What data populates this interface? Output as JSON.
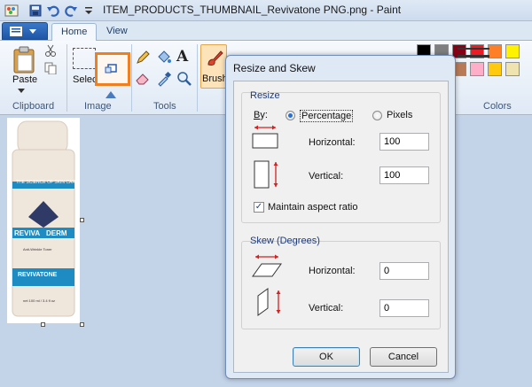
{
  "window": {
    "title": "ITEM_PRODUCTS_THUMBNAIL_Revivatone PNG.png - Paint"
  },
  "ribbon": {
    "tabs": [
      "Home",
      "View"
    ],
    "clipboard": {
      "paste_label": "Paste",
      "group_label": "Clipboard"
    },
    "image": {
      "select_label": "Select",
      "group_label": "Image"
    },
    "tools": {
      "group_label": "Tools"
    },
    "brushes": {
      "label": "Brushes"
    },
    "colors": {
      "group_label": "Colors"
    }
  },
  "colors": {
    "accent_highlight": "#f07f22",
    "palette_row1": [
      "#000000",
      "#7f7f7f",
      "#880015",
      "#ed1c24",
      "#ff7f27",
      "#fff200"
    ],
    "palette_row2": [
      "#ffffff",
      "#c3c3c3",
      "#b97a57",
      "#ffaec9",
      "#ffc90e",
      "#efe4b0"
    ]
  },
  "dialog": {
    "title": "Resize and Skew",
    "resize": {
      "group_label": "Resize",
      "by_label": "By:",
      "percentage_label": "Percentage",
      "pixels_label": "Pixels",
      "selected": "Percentage",
      "horizontal_label": "Horizontal:",
      "horizontal_value": "100",
      "vertical_label": "Vertical:",
      "vertical_value": "100",
      "maintain_aspect_label": "Maintain aspect ratio",
      "maintain_aspect_checked": true
    },
    "skew": {
      "group_label": "Skew (Degrees)",
      "horizontal_label": "Horizontal:",
      "horizontal_value": "0",
      "vertical_label": "Vertical:",
      "vertical_value": "0"
    },
    "ok_label": "OK",
    "cancel_label": "Cancel"
  },
  "product": {
    "brand_prefix": "REVIVA",
    "brand_suffix": "DERM",
    "tagline": "THE SCIENCE OF SKIN CARE",
    "subtitle": "Anti-Wrinkle Toner",
    "product_name": "REVIVATONE",
    "volume": "net 100 ml / 3.4 fl oz"
  }
}
